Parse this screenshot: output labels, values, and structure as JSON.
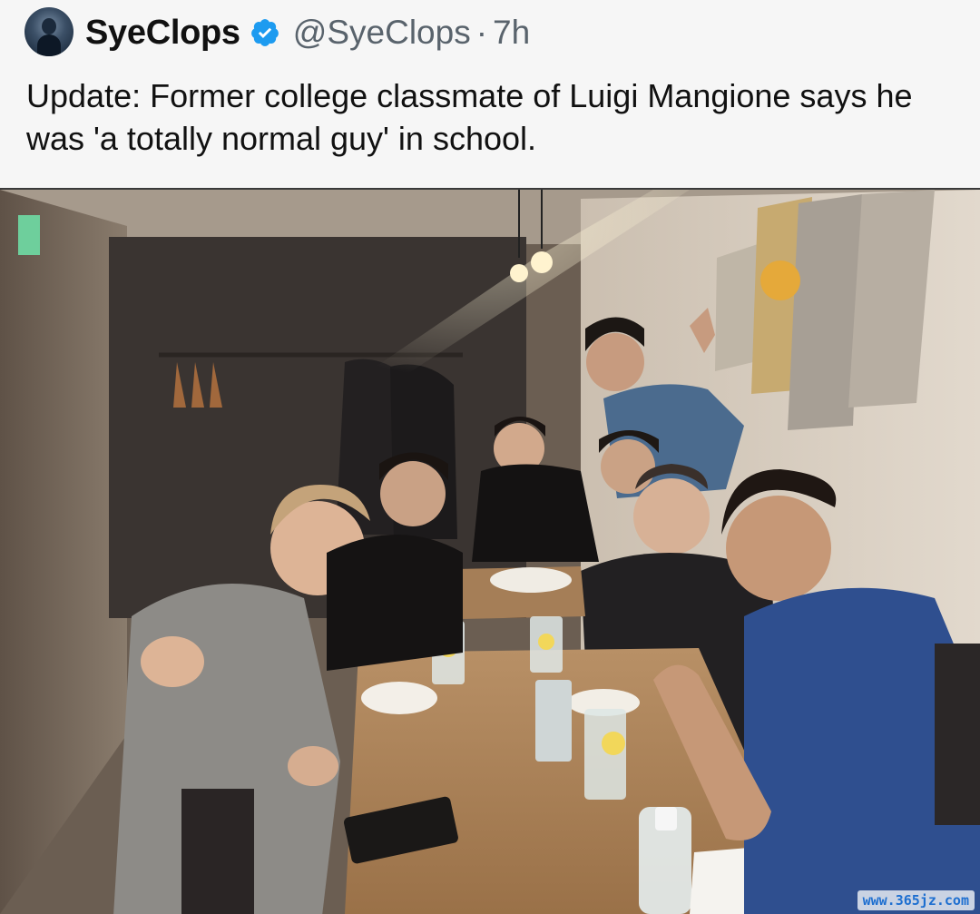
{
  "tweet": {
    "display_name": "SyeClops",
    "handle": "@SyeClops",
    "separator": "·",
    "time": "7h",
    "text": "Update: Former college classmate of Luigi Mangione says he was 'a totally normal guy' in school.",
    "avatar_icon": "user-avatar",
    "verified_icon": "verified-badge-icon",
    "verified_color": "#1d9bf0"
  },
  "photo": {
    "description_icon": "group-photo-restaurant",
    "watermark": "www.365jz.com"
  }
}
